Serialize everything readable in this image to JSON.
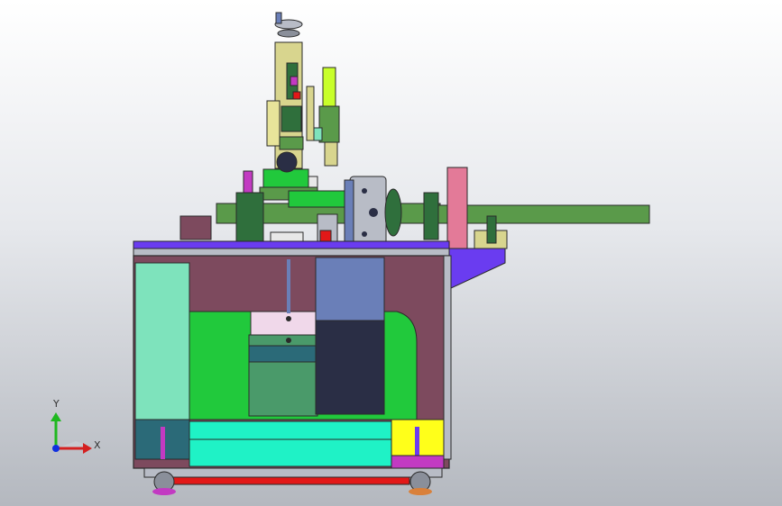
{
  "viewport": {
    "background_top": "#ffffff",
    "background_bottom": "#b4b8bf"
  },
  "triad": {
    "y_label": "Y",
    "x_label": "X",
    "y_color": "#1fb81f",
    "x_color": "#d42020",
    "z_color": "#1030e0"
  },
  "model": {
    "colors": {
      "frame_outline": "#2a2a2a",
      "panel_maroon": "#7d4a5e",
      "panel_mint": "#7ee3bc",
      "panel_green": "#21c93c",
      "panel_slate": "#6a7fb8",
      "panel_navy": "#2a2e45",
      "panel_teal": "#2b6a78",
      "panel_aqua": "#1ff2c6",
      "panel_yellow": "#ffff1a",
      "shaft_green": "#5a9a4a",
      "spindle_green": "#2f6f3c",
      "plate_pink": "#e37a98",
      "bracket_violet": "#6a3cf0",
      "base_red": "#e21818",
      "wheel_purple": "#c23ac2",
      "wheel_orange": "#d9803a",
      "disc_gray": "#b8bcc6",
      "column_tan": "#d8d58e",
      "lime": "#c8ff2a"
    }
  }
}
